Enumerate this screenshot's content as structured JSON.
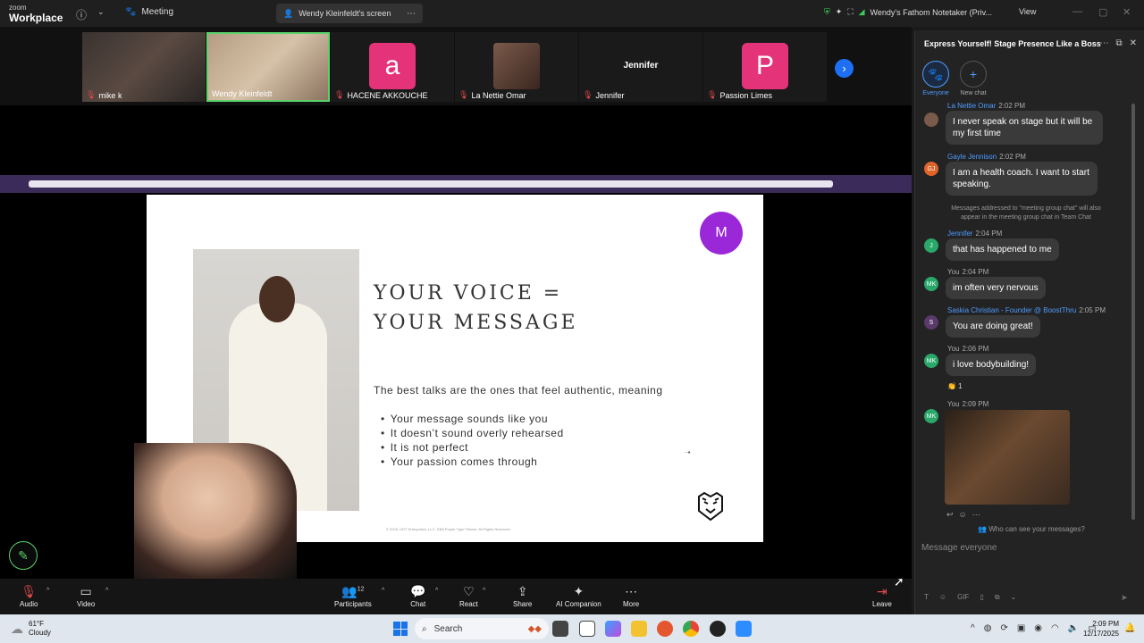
{
  "titlebar": {
    "logo_top": "zoom",
    "logo_bottom": "Workplace",
    "meeting_label": "Meeting",
    "screen_label": "Wendy Kleinfeldt's screen",
    "notetaker_label": "Wendy's Fathom Notetaker (Priv...",
    "view_label": "View"
  },
  "participants": [
    {
      "name": "mike k",
      "type": "video"
    },
    {
      "name": "Wendy Kleinfeldt",
      "type": "video",
      "active": true
    },
    {
      "name": "HACENE AKKOUCHE",
      "type": "avatar",
      "letter": "a",
      "color": "#e5337a"
    },
    {
      "name": "La Nettie Omar",
      "type": "video"
    },
    {
      "name": "Jennifer",
      "type": "name",
      "display": "Jennifer"
    },
    {
      "name": "Passion Limes",
      "type": "avatar",
      "letter": "P",
      "color": "#e5337a"
    }
  ],
  "slide": {
    "title_line1": "YOUR VOICE =",
    "title_line2": "YOUR MESSAGE",
    "intro": "The best talks are the ones that feel authentic, meaning",
    "bullets": [
      "Your message sounds like you",
      "It doesn’t sound overly rehearsed",
      "It is not perfect",
      "Your passion comes through"
    ],
    "badge_letter": "M",
    "footer": "© 2025. HOT Enterprises, LLC. DBA Purple Tiger Fitness. All Rights Reserved."
  },
  "toolbar": {
    "audio": "Audio",
    "video": "Video",
    "participants": "Participants",
    "participants_count": "12",
    "chat": "Chat",
    "react": "React",
    "share": "Share",
    "ai": "AI Companion",
    "more": "More",
    "leave": "Leave"
  },
  "chat": {
    "title": "Express Yourself! Stage Presence Like a Boss",
    "tab_everyone": "Everyone",
    "tab_new": "New chat",
    "messages": [
      {
        "sender": "La Nettie Omar",
        "time": "2:02 PM",
        "text": "I never speak on stage but it will be my first time",
        "avatar_color": "#7a5a4a",
        "initials": ""
      },
      {
        "sender": "Gayle Jennison",
        "time": "2:02 PM",
        "text": "I am a health coach. I want to start speaking.",
        "avatar_color": "#e0642a",
        "initials": "GJ"
      },
      {
        "sender": "Jennifer",
        "time": "2:04 PM",
        "text": "that has happened to me",
        "avatar_color": "#2aa86a",
        "initials": "J"
      },
      {
        "sender": "You",
        "time": "2:04 PM",
        "text": "im often very nervous",
        "avatar_color": "#2aa86a",
        "initials": "MK"
      },
      {
        "sender": "Saskia Christian - Founder @ BoostThru",
        "time": "2:05 PM",
        "text": "You are doing great!",
        "avatar_color": "#5a3a6a",
        "initials": "S"
      },
      {
        "sender": "You",
        "time": "2:06 PM",
        "text": "i love bodybuilding!",
        "avatar_color": "#2aa86a",
        "initials": "MK"
      },
      {
        "sender": "You",
        "time": "2:09 PM",
        "text": "",
        "avatar_color": "#2aa86a",
        "initials": "MK"
      }
    ],
    "system_note": "Messages addressed to \"meeting group chat\" will also appear in the meeting group chat in Team Chat",
    "reaction": "👏 1",
    "who_can_see": "Who can see your messages?",
    "input_placeholder": "Message everyone",
    "gif_label": "GIF"
  },
  "taskbar": {
    "temp": "61°F",
    "condition": "Cloudy",
    "search": "Search",
    "time": "2:09 PM",
    "date": "12/17/2025"
  }
}
